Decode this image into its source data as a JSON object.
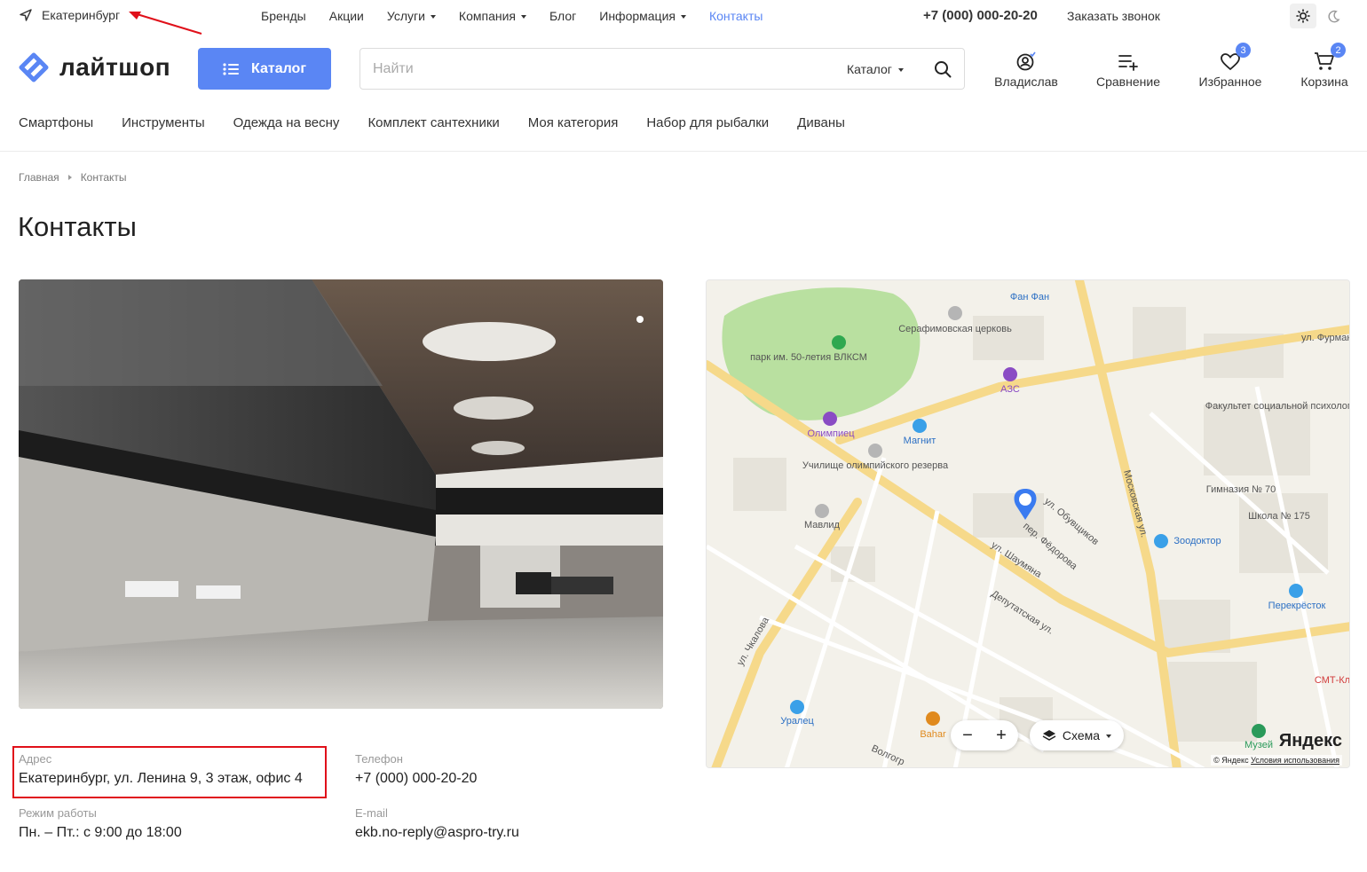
{
  "topbar": {
    "city": "Екатеринбург",
    "nav": [
      {
        "label": "Бренды",
        "dropdown": false,
        "active": false
      },
      {
        "label": "Акции",
        "dropdown": false,
        "active": false
      },
      {
        "label": "Услуги",
        "dropdown": true,
        "active": false
      },
      {
        "label": "Компания",
        "dropdown": true,
        "active": false
      },
      {
        "label": "Блог",
        "dropdown": false,
        "active": false
      },
      {
        "label": "Информация",
        "dropdown": true,
        "active": false
      },
      {
        "label": "Контакты",
        "dropdown": false,
        "active": true
      }
    ],
    "phone": "+7 (000) 000-20-20",
    "callback": "Заказать звонок",
    "theme_icons": [
      "sun-icon",
      "moon-icon"
    ]
  },
  "header": {
    "logo_text": "лайтшоп",
    "catalog_label": "Каталог",
    "search": {
      "placeholder": "Найти",
      "scope": "Каталог"
    },
    "icons": [
      {
        "name": "user-icon",
        "label": "Владислав",
        "badge": ""
      },
      {
        "name": "compare-icon",
        "label": "Сравнение",
        "badge": ""
      },
      {
        "name": "heart-icon",
        "label": "Избранное",
        "badge": "3"
      },
      {
        "name": "cart-icon",
        "label": "Корзина",
        "badge": "2"
      }
    ]
  },
  "categories": [
    "Смартфоны",
    "Инструменты",
    "Одежда на весну",
    "Комплект сантехники",
    "Моя категория",
    "Набор для рыбалки",
    "Диваны"
  ],
  "breadcrumbs": [
    "Главная",
    "Контакты"
  ],
  "page_title": "Контакты",
  "map": {
    "labels": {
      "park": "парк им. 50-летия ВЛКСМ",
      "church": "Серафимовская церковь",
      "fanfan": "Фан Фан",
      "azs": "АЗС",
      "olimpiec": "Олимпиец",
      "magnit": "Магнит",
      "school": "Училище олимпийского резерва",
      "mavlid": "Мавлид",
      "faculty": "Факультет социальной психологии",
      "gym70": "Гимназия № 70",
      "school175": "Школа № 175",
      "zoodoktor": "Зоодоктор",
      "perekrestok": "Перекрёсток",
      "uralec": "Уралец",
      "bahar": "Bahar",
      "museum": "Музей",
      "smt": "СМТ-Кл",
      "st_furmanova": "ул. Фурманова",
      "st_shaumyana": "ул. Шаумяна",
      "st_moskovskaya": "Московская ул.",
      "st_chkalova": "ул. Чкалова",
      "st_deputatskaya": "Депутатская ул.",
      "st_obuvshikov": "ул. Обувщиков",
      "st_fedorova": "пер. Фёдорова",
      "st_volgogr": "Волгогр"
    },
    "scheme_label": "Схема",
    "zoom_out": "−",
    "zoom_in": "+",
    "logo": "Яндекс",
    "copyright": "© Яндекс",
    "terms": "Условия использования"
  },
  "contacts": {
    "address_label": "Адрес",
    "address": "Екатеринбург, ул. Ленина 9, 3 этаж, офис 4",
    "phone_label": "Телефон",
    "phone": "+7 (000) 000-20-20",
    "hours_label": "Режим работы",
    "hours": "Пн. – Пт.: с 9:00 до 18:00",
    "email_label": "E-mail",
    "email": "ekb.no-reply@aspro-try.ru"
  },
  "colors": {
    "accent": "#5a86f4",
    "highlight": "#e0101a"
  }
}
